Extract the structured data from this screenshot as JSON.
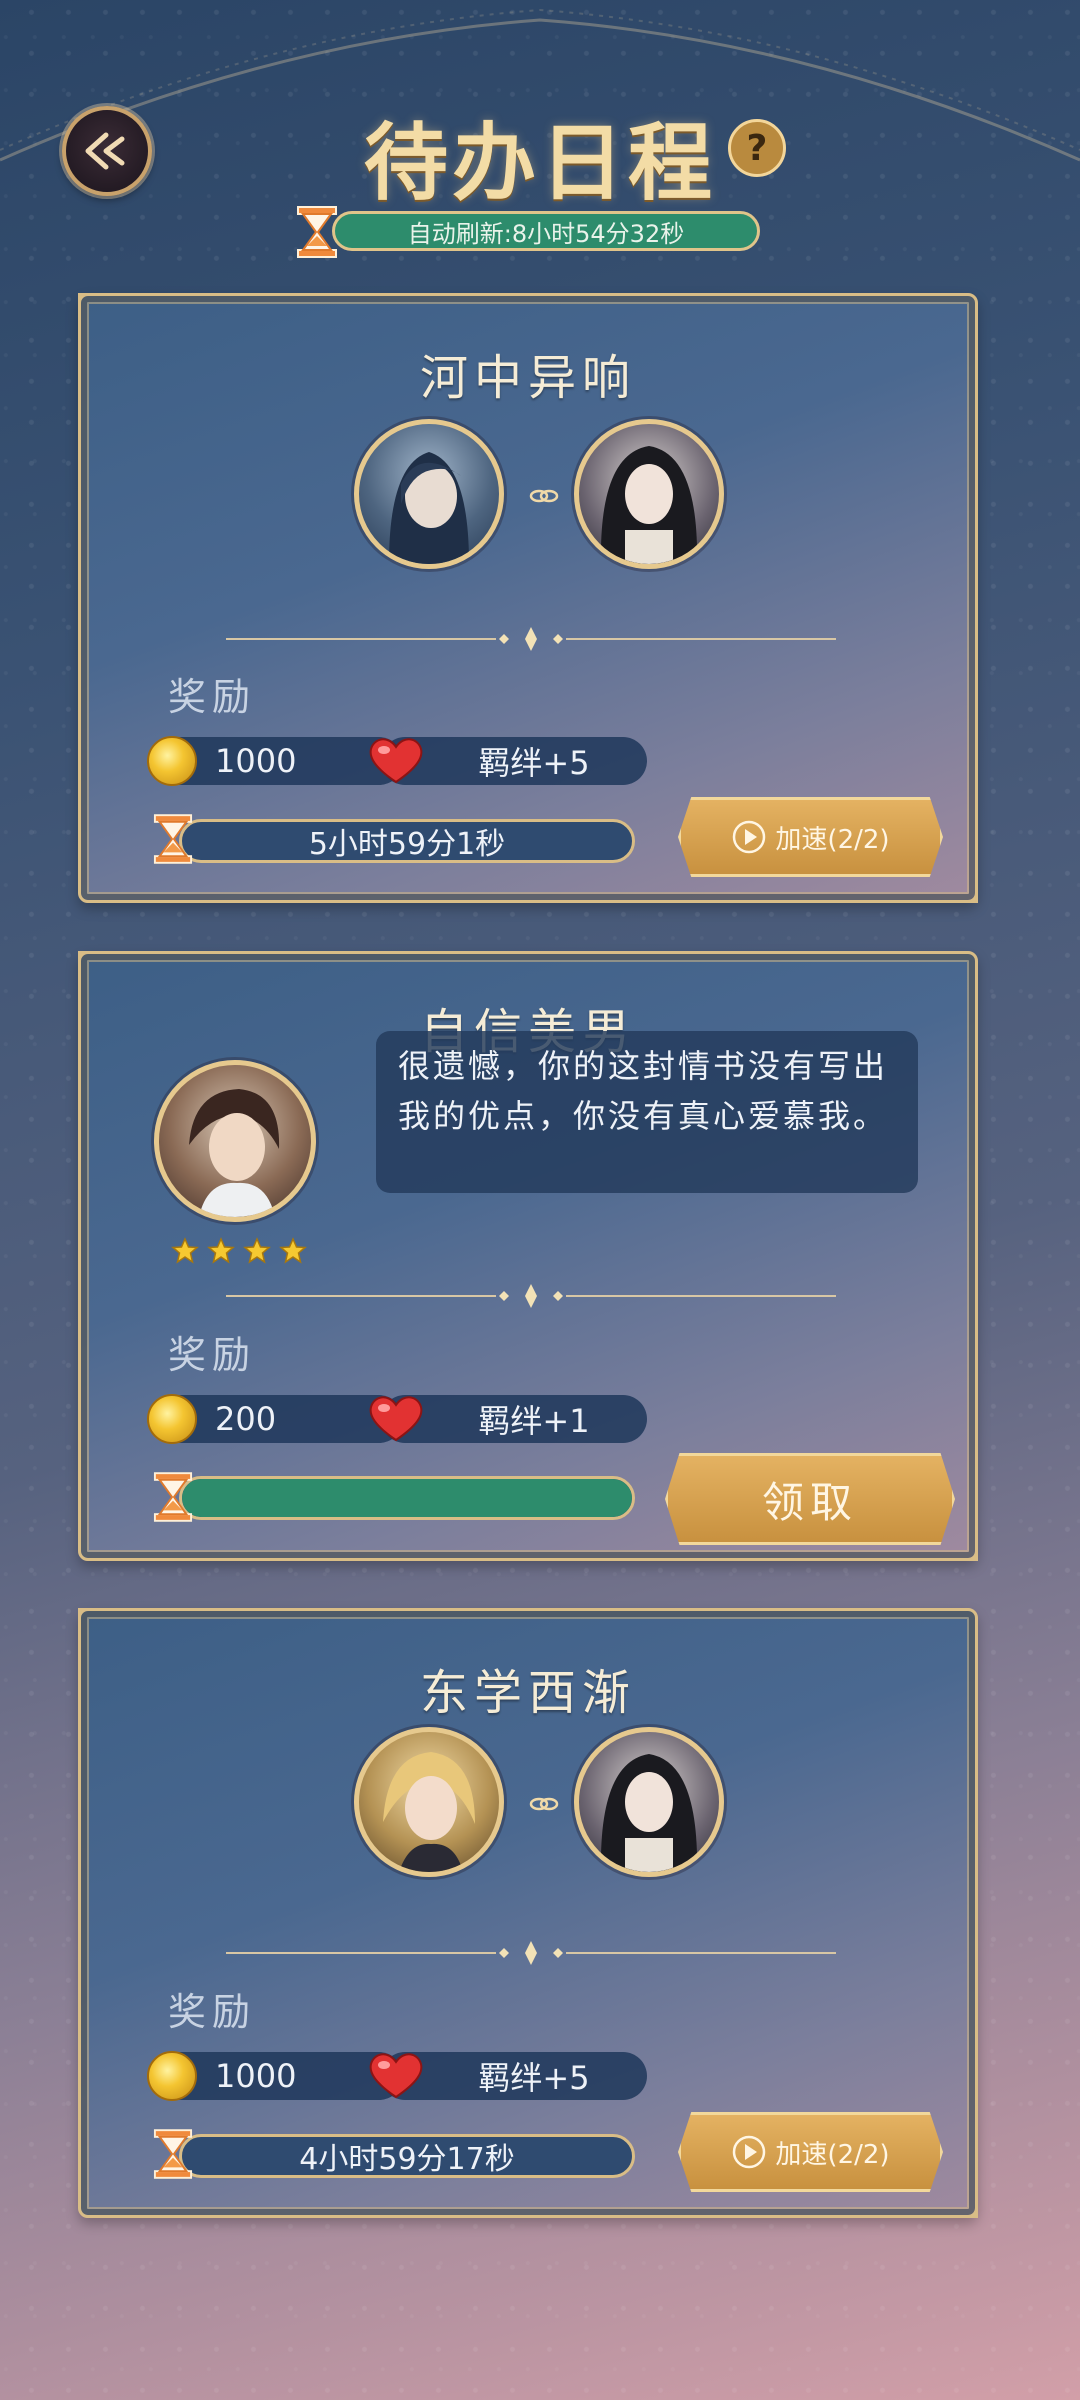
{
  "header": {
    "title": "待办日程",
    "help_label": "?",
    "refresh_text": "自动刷新:8小时54分32秒"
  },
  "cards": [
    {
      "title": "河中异响",
      "reward_label": "奖励",
      "coins": "1000",
      "bond": "羁绊+5",
      "timer": "5小时59分1秒",
      "action_label": "加速(2/2)"
    },
    {
      "title": "自信美男",
      "message": "很遗憾，你的这封情书没有写出我的优点，你没有真心爱慕我。",
      "stars": 4,
      "reward_label": "奖励",
      "coins": "200",
      "bond": "羁绊+1",
      "progress": 1.0,
      "action_label": "领取"
    },
    {
      "title": "东学西渐",
      "reward_label": "奖励",
      "coins": "1000",
      "bond": "羁绊+5",
      "timer": "4小时59分17秒",
      "action_label": "加速(2/2)"
    }
  ],
  "colors": {
    "gold": "#d9bd86",
    "progress_green": "#2d8c6c",
    "title_gold": "#f3dca6"
  }
}
